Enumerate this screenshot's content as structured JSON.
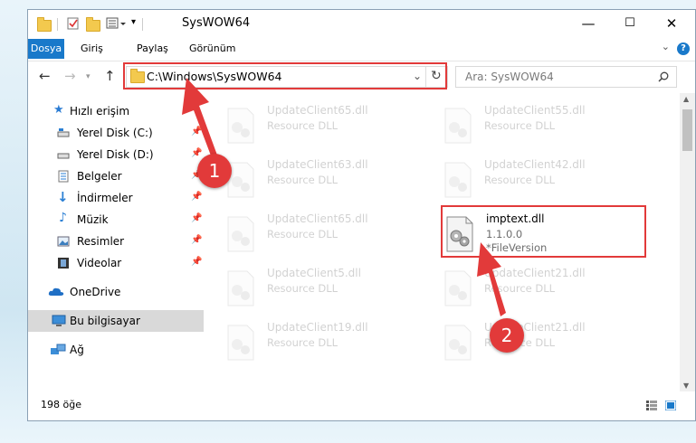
{
  "window": {
    "title": "SysWOW64",
    "controls": {
      "minimize": "—",
      "maximize": "☐",
      "close": "✕"
    }
  },
  "ribbon": {
    "tabs": [
      {
        "label": "Dosya",
        "active": true
      },
      {
        "label": "Giriş",
        "active": false
      },
      {
        "label": "Paylaş",
        "active": false
      },
      {
        "label": "Görünüm",
        "active": false
      }
    ],
    "help": "?"
  },
  "nav": {
    "path": "C:\\Windows\\SysWOW64",
    "search_placeholder": "Ara: SysWOW64"
  },
  "sidebar": {
    "items": [
      {
        "label": "Hızlı erişim",
        "icon": "star-icon"
      },
      {
        "label": "Yerel Disk (C:)",
        "icon": "drive-icon",
        "pinned": true
      },
      {
        "label": "Yerel Disk (D:)",
        "icon": "drive-icon",
        "pinned": true
      },
      {
        "label": "Belgeler",
        "icon": "documents-icon",
        "pinned": true
      },
      {
        "label": "İndirmeler",
        "icon": "download-icon",
        "pinned": true
      },
      {
        "label": "Müzik",
        "icon": "music-icon",
        "pinned": true
      },
      {
        "label": "Resimler",
        "icon": "pictures-icon",
        "pinned": true
      },
      {
        "label": "Videolar",
        "icon": "videos-icon",
        "pinned": true
      },
      {
        "label": "OneDrive",
        "icon": "cloud-icon"
      },
      {
        "label": "Bu bilgisayar",
        "icon": "computer-icon",
        "selected": true
      },
      {
        "label": "Ağ",
        "icon": "network-icon"
      }
    ]
  },
  "files": [
    {
      "name": "UpdateClient65.dll",
      "d1": "Resource DLL",
      "d2": ""
    },
    {
      "name": "UpdateClient55.dll",
      "d1": "Resource DLL",
      "d2": ""
    },
    {
      "name": "UpdateClient63.dll",
      "d1": "Resource DLL",
      "d2": ""
    },
    {
      "name": "UpdateClient42.dll",
      "d1": "Resource DLL",
      "d2": ""
    },
    {
      "name": "UpdateClient65.dll",
      "d1": "Resource DLL",
      "d2": ""
    },
    {
      "name": "imptext.dll",
      "d1": "1.1.0.0",
      "d2": "*FileVersion"
    },
    {
      "name": "UpdateClient5.dll",
      "d1": "Resource DLL",
      "d2": ""
    },
    {
      "name": "UpdateClient21.dll",
      "d1": "Resource DLL",
      "d2": ""
    },
    {
      "name": "UpdateClient19.dll",
      "d1": "Resource DLL",
      "d2": ""
    },
    {
      "name": "UpdateClient21.dll",
      "d1": "Resource DLL",
      "d2": ""
    }
  ],
  "status": {
    "count": "198 öğe"
  },
  "annotations": {
    "badge1": "1",
    "badge2": "2",
    "color": "#e23a3a"
  },
  "colors": {
    "accent": "#1979ca",
    "folder": "#f3c94e"
  }
}
